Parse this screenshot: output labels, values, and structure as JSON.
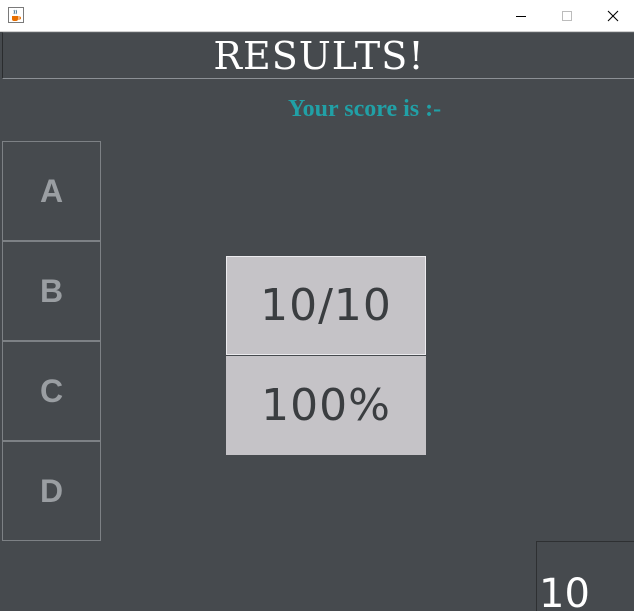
{
  "window": {
    "controls": {
      "minimize_icon": "minimize-icon",
      "maximize_icon": "maximize-icon",
      "close_icon": "close-icon"
    },
    "app_icon": "java-cup-icon"
  },
  "header": {
    "title": "RESULTS!"
  },
  "caption": "Your score is :-",
  "options": [
    "A",
    "B",
    "C",
    "D"
  ],
  "score": {
    "fraction": "10/10",
    "percent": "100%"
  },
  "corner_value": "10",
  "colors": {
    "background": "#464a4e",
    "caption": "#21a0a6",
    "score_box": "#c5c3c7",
    "option_text": "#9a9ea2"
  }
}
